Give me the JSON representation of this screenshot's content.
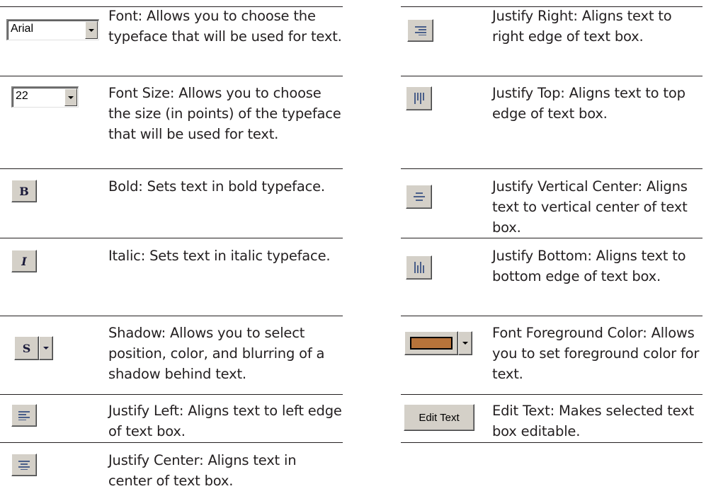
{
  "left_rows": [
    {
      "control": "Arial",
      "label": "Font: Allows you to choose the typeface that will be used for text."
    },
    {
      "control": "22",
      "label": "Font Size: Allows you to choose the size (in points) of the typeface that will be used for text."
    },
    {
      "control": "B",
      "label": "Bold: Sets text in bold typeface."
    },
    {
      "control": "I",
      "label": "Italic: Sets text in italic typeface."
    },
    {
      "control": "S",
      "label": "Shadow: Allows you to select position, color, and blurring of a shadow behind text."
    },
    {
      "control": "",
      "label": "Justify Left: Aligns text to left edge of text box."
    },
    {
      "control": "",
      "label": "Justify Center: Aligns text in center of text box."
    }
  ],
  "right_rows": [
    {
      "control": "",
      "label": "Justify Right: Aligns text to right edge of text box."
    },
    {
      "control": "",
      "label": "Justify Top: Aligns text to top edge of text box."
    },
    {
      "control": "",
      "label": "Justify Vertical Center: Aligns text to vertical center of text box."
    },
    {
      "control": "",
      "label": "Justify Bottom: Aligns text to bottom edge of text box."
    },
    {
      "control": "",
      "label": "Font Foreground Color: Allows you to set foreground color for text."
    },
    {
      "control": "Edit Text",
      "label": "Edit Text: Makes selected text box editable."
    }
  ],
  "icons": {
    "font": "dropdown-icon",
    "justify_left": "align-left-icon",
    "justify_center": "align-center-icon",
    "justify_right": "align-right-icon",
    "justify_top": "align-top-icon",
    "justify_vcenter": "align-vertical-center-icon",
    "justify_bottom": "align-bottom-icon",
    "foreground_color": "color-swatch-icon"
  },
  "colors": {
    "icon_blue": "#4a5f8a",
    "button_face": "#d4d0c8",
    "foreground_swatch": "#b7733a"
  }
}
